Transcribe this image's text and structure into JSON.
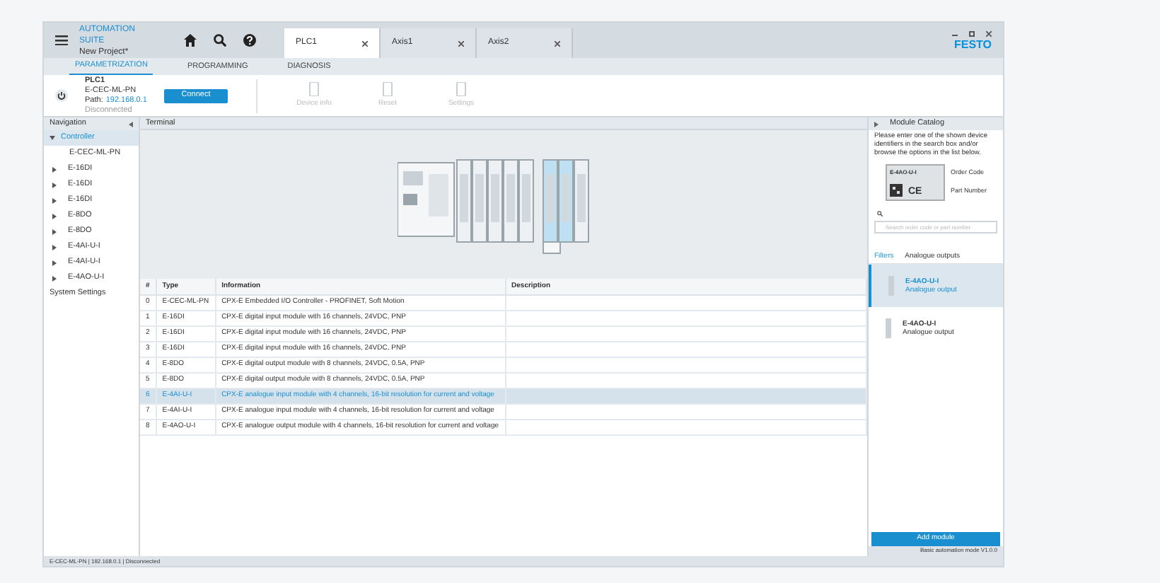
{
  "app": {
    "title": "AUTOMATION SUITE",
    "project": "New Project*",
    "logo": "FESTO"
  },
  "doc_tabs": [
    {
      "label": "PLC1",
      "selected": true
    },
    {
      "label": "Axis1",
      "selected": false
    },
    {
      "label": "Axis2",
      "selected": false
    }
  ],
  "subtabs": [
    {
      "label": "PARAMETRIZATION",
      "selected": true
    },
    {
      "label": "PROGRAMMING",
      "selected": false
    },
    {
      "label": "DIAGNOSIS",
      "selected": false
    }
  ],
  "device": {
    "name": "PLC1",
    "type": "E-CEC-ML-PN",
    "path_label": "Path:",
    "path": "192.168.0.1",
    "status": "Disconnected",
    "button": "Connect"
  },
  "toolbar": [
    {
      "label": "Device info",
      "disabled": true
    },
    {
      "label": "Reset",
      "disabled": true
    },
    {
      "label": "Settings",
      "disabled": true
    }
  ],
  "navigation": {
    "title": "Navigation",
    "items": [
      {
        "label": "Controller",
        "selected": true,
        "expanded": true,
        "children": [
          {
            "label": "E-CEC-ML-PN"
          },
          {
            "label": "E-16DI"
          },
          {
            "label": "E-16DI"
          },
          {
            "label": "E-16DI"
          },
          {
            "label": "E-8DO"
          },
          {
            "label": "E-8DO"
          },
          {
            "label": "E-4AI-U-I"
          },
          {
            "label": "E-4AI-U-I"
          },
          {
            "label": "E-4AO-U-I"
          }
        ]
      },
      {
        "label": "System Settings",
        "selected": false,
        "expanded": false
      }
    ]
  },
  "terminal": {
    "title": "Terminal",
    "columns": [
      "#",
      "Type",
      "Information",
      "Description"
    ],
    "rows": [
      {
        "cells": [
          "0",
          "E-CEC-ML-PN",
          "CPX-E Embedded I/O Controller - PROFINET, Soft Motion",
          ""
        ],
        "selected": false
      },
      {
        "cells": [
          "1",
          "E-16DI",
          "CPX-E digital input module with 16 channels, 24VDC, PNP",
          ""
        ],
        "selected": false
      },
      {
        "cells": [
          "2",
          "E-16DI",
          "CPX-E digital input module with 16 channels, 24VDC, PNP",
          ""
        ],
        "selected": false
      },
      {
        "cells": [
          "3",
          "E-16DI",
          "CPX-E digital input module with 16 channels, 24VDC, PNP",
          ""
        ],
        "selected": false
      },
      {
        "cells": [
          "4",
          "E-8DO",
          "CPX-E digital output module with 8 channels, 24VDC, 0.5A, PNP",
          ""
        ],
        "selected": false
      },
      {
        "cells": [
          "5",
          "E-8DO",
          "CPX-E digital output module with 8 channels, 24VDC, 0.5A, PNP",
          ""
        ],
        "selected": false
      },
      {
        "cells": [
          "6",
          "E-4AI-U-I",
          "CPX-E analogue input module with 4 channels, 16-bit resolution for current and voltage",
          ""
        ],
        "selected": true
      },
      {
        "cells": [
          "7",
          "E-4AI-U-I",
          "CPX-E analogue input module with 4 channels, 16-bit resolution for current and voltage",
          ""
        ],
        "selected": false
      },
      {
        "cells": [
          "8",
          "E-4AO-U-I",
          "CPX-E analogue output module with 4 channels, 16-bit resolution for current and voltage",
          ""
        ],
        "selected": false
      }
    ]
  },
  "catalog": {
    "title": "Module Catalog",
    "instructions": "Please enter one of the shown device identifiers in the search box and/or browse the options in the list below.",
    "label_order": "Order Code",
    "label_part": "Part Number",
    "label_code": "E-4AO-U-I",
    "label_mark": "CE",
    "search_placeholder": "Search order code or part number",
    "breadcrumb": [
      "Filters",
      "Analogue outputs"
    ],
    "items": [
      {
        "name": "E-4AO-U-I",
        "desc": "Analogue output",
        "selected": true
      },
      {
        "name": "E-4AO-U-I",
        "desc": "Analogue output",
        "selected": false
      }
    ],
    "button": "Add module",
    "version": "Basic automation mode V1.0.0"
  },
  "status_bar": "E-CEC-ML-PN | 192.168.0.1 | Disconnected"
}
